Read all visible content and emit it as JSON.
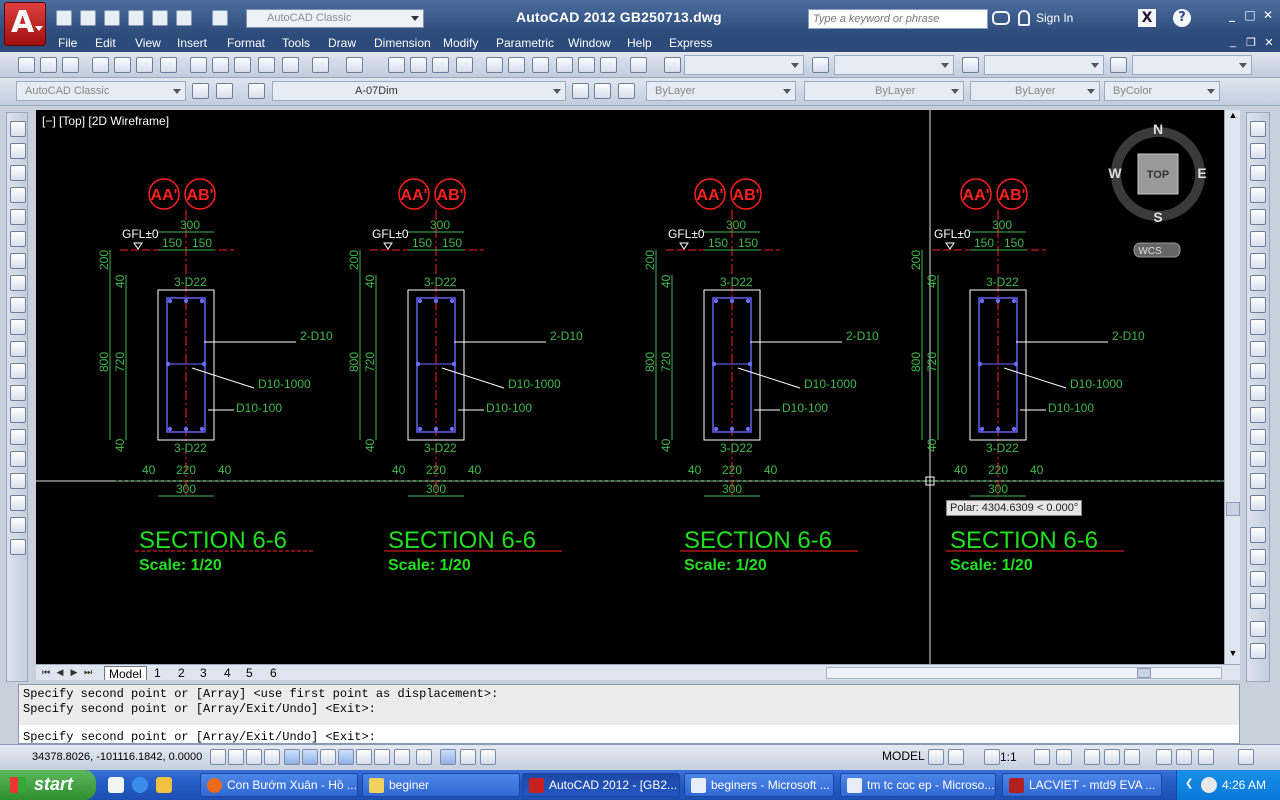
{
  "titlebar": {
    "title": "AutoCAD 2012    GB250713.dwg",
    "workspace": "AutoCAD Classic",
    "search_placeholder": "Type a keyword or phrase",
    "sign_in": "Sign In"
  },
  "menu": [
    "File",
    "Edit",
    "View",
    "Insert",
    "Format",
    "Tools",
    "Draw",
    "Dimension",
    "Modify",
    "Parametric",
    "Window",
    "Help",
    "Express"
  ],
  "toolbar2": {
    "workspace": "AutoCAD Classic",
    "layer": "A-07Dim",
    "linetype_color": "ByLayer",
    "linetype": "ByLayer",
    "lineweight": "ByLayer",
    "plot_style": "ByColor"
  },
  "viewport": {
    "label": "[−] [Top] [2D Wireframe]",
    "viewcube": {
      "north": "N",
      "south": "S",
      "east": "E",
      "west": "W",
      "face": "TOP",
      "ucs": "WCS"
    },
    "polar_tooltip": "Polar: 4304.6309 < 0.000°"
  },
  "sections": [
    {
      "title": "SECTION 6-6",
      "scale": "Scale: 1/20"
    },
    {
      "title": "SECTION 6-6",
      "scale": "Scale: 1/20"
    },
    {
      "title": "SECTION 6-6",
      "scale": "Scale: 1/20"
    },
    {
      "title": "SECTION 6-6",
      "scale": "Scale: 1/20"
    }
  ],
  "section_labels": {
    "bubble_a": "AA'",
    "bubble_b": "AB'",
    "gfl": "GFL±0",
    "top_width": "300",
    "half_a": "150",
    "half_b": "150",
    "top_bars": "3-D22",
    "bottom_bars": "3-D22",
    "side_bars": "2-D10",
    "stirrup_1": "D10-1000",
    "stirrup_2": "D10-100",
    "dim_200": "200",
    "dim_40_top": "40",
    "dim_800": "800",
    "dim_720": "720",
    "dim_40_bot": "40",
    "bot_40_left": "40",
    "bot_220": "220",
    "bot_40_right": "40",
    "bot_300": "300"
  },
  "layout_tabs": [
    "Model",
    "1",
    "2",
    "3",
    "4",
    "5",
    "6"
  ],
  "command_line": {
    "history": [
      "Specify second point or [Array] <use first point as displacement>:",
      "Specify second point or [Array/Exit/Undo] <Exit>:"
    ],
    "prompt": "Specify second point or [Array/Exit/Undo] <Exit>:"
  },
  "status": {
    "coordinates": "34378.8026, -101116.1842, 0.0000",
    "model": "MODEL",
    "annotation_scale": "1:1"
  },
  "taskbar": {
    "start": "start",
    "tasks": [
      {
        "label": "Con Bướm Xuân - Hồ ...",
        "active": false
      },
      {
        "label": "beginer",
        "active": false
      },
      {
        "label": "AutoCAD 2012 - [GB2...",
        "active": true
      },
      {
        "label": "beginers - Microsoft ...",
        "active": false
      },
      {
        "label": "tm tc coc ep - Microso...",
        "active": false
      },
      {
        "label": "LACVIET - mtd9 EVA ...",
        "active": false
      }
    ],
    "clock": "4:26 AM"
  },
  "colors": {
    "canvas": "#000000",
    "dimension": "#3fb84a",
    "bubble": "#ff2020",
    "rebar": "#6a6aff",
    "title_green": "#20e020"
  }
}
